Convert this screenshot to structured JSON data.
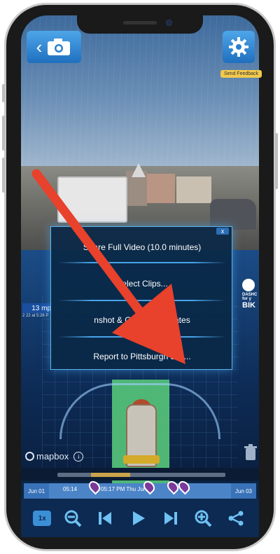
{
  "top_bar": {
    "send_feedback": "Send Feedback"
  },
  "overlay": {
    "speed": "13 mp",
    "timestamp": "2 22 at 5:26 P"
  },
  "brand": {
    "line1": "DASHC",
    "line2": "for y",
    "line3": "BIK"
  },
  "share_menu": {
    "close_label": "x",
    "items": [
      {
        "label": "Share Full Video (10.0 minutes)"
      },
      {
        "label": "Select Clips..."
      },
      {
        "label": "nshot & GPS Coordinates"
      },
      {
        "label": "Report to Pittsburgh 311..."
      }
    ]
  },
  "map": {
    "attribution": "mapbox",
    "info": "i"
  },
  "timeline": {
    "date_left": "Jun 01",
    "start_time": "05:14",
    "mid_time": "05:17 PM Thu Jun 02",
    "date_right": "Jun 03"
  },
  "controls": {
    "speed": "1x"
  },
  "colors": {
    "accent": "#4ea6e8",
    "menu_border": "#5bb5ee",
    "arrow": "#e8412c",
    "lane": "#56c77a"
  }
}
